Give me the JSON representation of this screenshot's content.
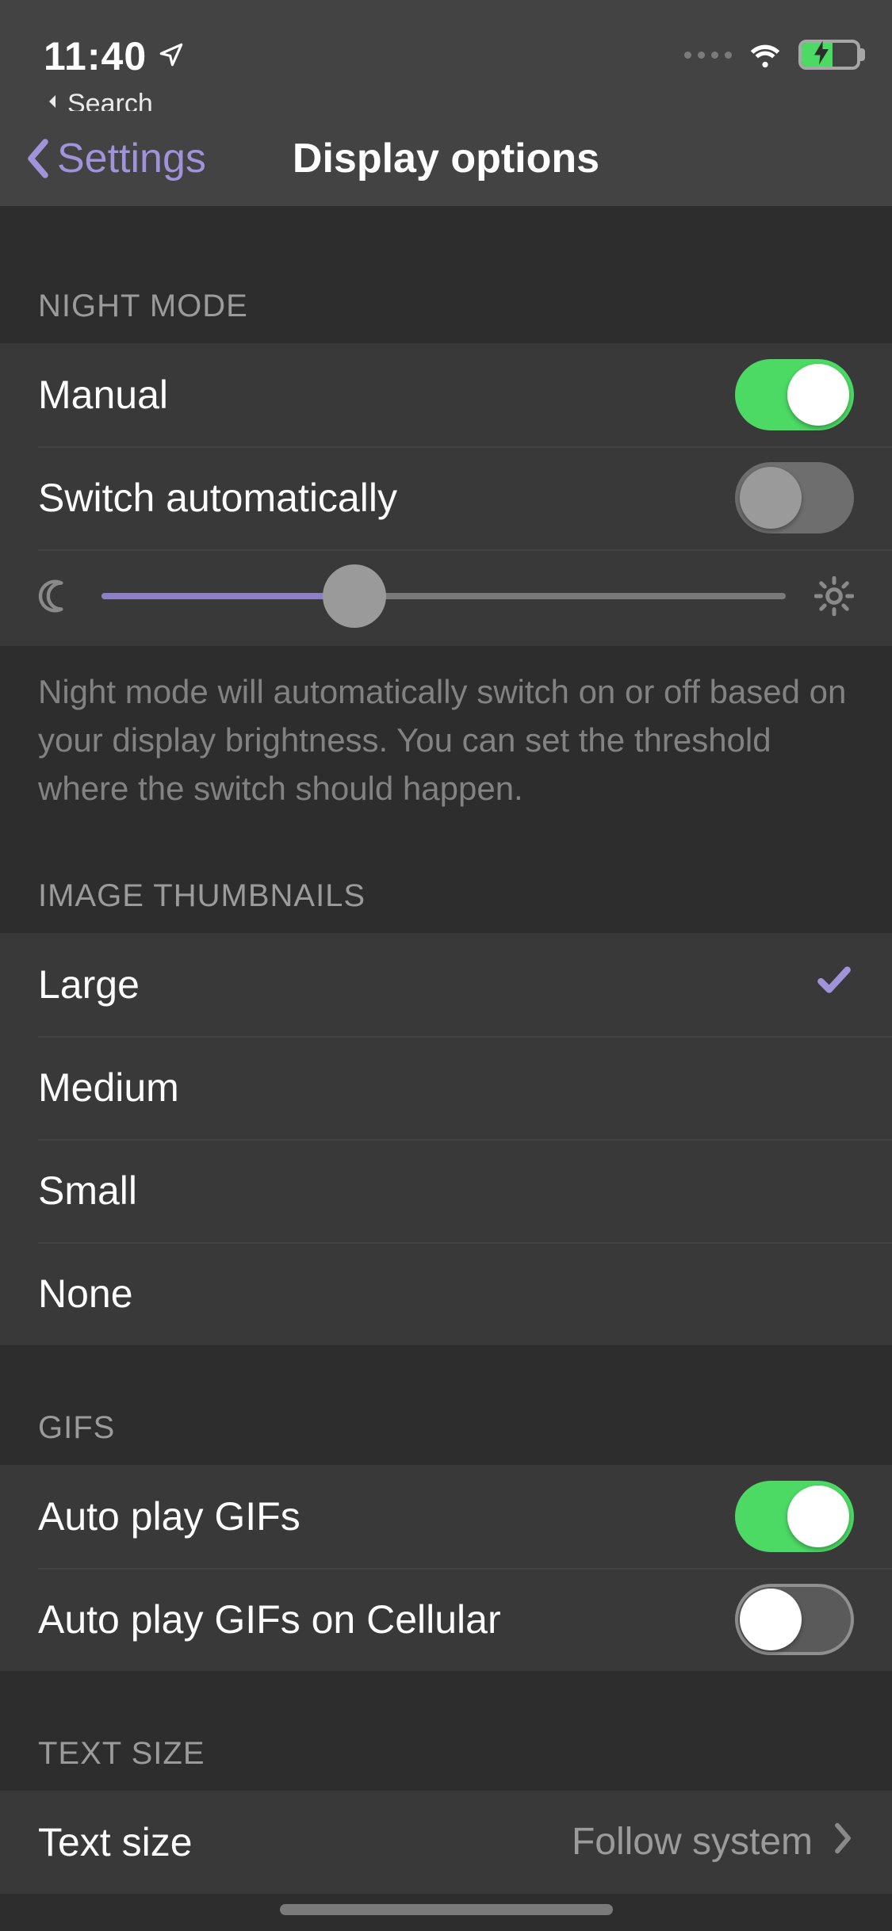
{
  "status": {
    "time": "11:40",
    "back_app": "Search"
  },
  "nav": {
    "back_label": "Settings",
    "title": "Display options"
  },
  "sections": {
    "night_mode": {
      "header": "NIGHT MODE",
      "manual_label": "Manual",
      "manual_on": true,
      "auto_label": "Switch automatically",
      "auto_on": false,
      "slider_percent": 37,
      "footer": "Night mode will automatically switch on or off based on your display brightness. You can set the threshold where the switch should happen."
    },
    "thumbnails": {
      "header": "IMAGE THUMBNAILS",
      "options": {
        "large": "Large",
        "medium": "Medium",
        "small": "Small",
        "none": "None"
      },
      "selected": "large"
    },
    "gifs": {
      "header": "GIFS",
      "autoplay_label": "Auto play GIFs",
      "autoplay_on": true,
      "cellular_label": "Auto play GIFs on Cellular",
      "cellular_on": false
    },
    "text_size": {
      "header": "TEXT SIZE",
      "label": "Text size",
      "value": "Follow system"
    }
  }
}
